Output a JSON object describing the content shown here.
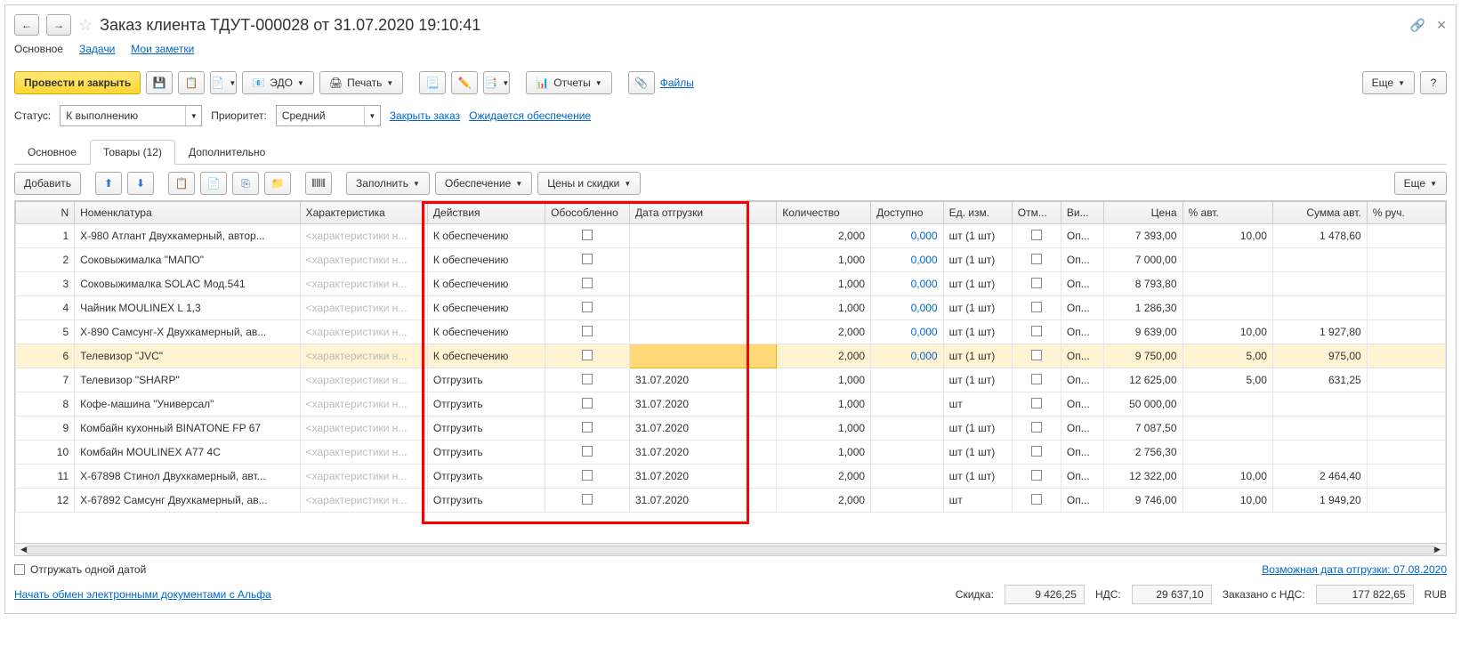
{
  "header": {
    "title": "Заказ клиента ТДУТ-000028 от 31.07.2020 19:10:41"
  },
  "nav": {
    "main": "Основное",
    "tasks": "Задачи",
    "notes": "Мои заметки"
  },
  "toolbar": {
    "post_close": "Провести и закрыть",
    "edo": "ЭДО",
    "print": "Печать",
    "reports": "Отчеты",
    "files": "Файлы",
    "more": "Еще",
    "help": "?"
  },
  "status": {
    "status_label": "Статус:",
    "status_value": "К выполнению",
    "priority_label": "Приоритет:",
    "priority_value": "Средний",
    "close_order": "Закрыть заказ",
    "await_supply": "Ожидается обеспечение"
  },
  "tabs": {
    "main": "Основное",
    "goods": "Товары (12)",
    "addl": "Дополнительно"
  },
  "toolbar2": {
    "add": "Добавить",
    "fill": "Заполнить",
    "supply": "Обеспечение",
    "prices": "Цены и скидки",
    "more": "Еще"
  },
  "columns": {
    "n": "N",
    "name": "Номенклатура",
    "char": "Характеристика",
    "actions": "Действия",
    "obos": "Обособленно",
    "ship_date": "Дата отгрузки",
    "qty": "Количество",
    "avail": "Доступно",
    "unit": "Ед. изм.",
    "otm": "Отм...",
    "vi": "Ви...",
    "price": "Цена",
    "pct_auto": "% авт.",
    "sum_auto": "Сумма авт.",
    "pct_man": "% руч."
  },
  "char_placeholder": "<характеристики н...",
  "rows": [
    {
      "n": 1,
      "name": "Х-980 Атлант Двухкамерный, автор...",
      "action": "К обеспечению",
      "date": "",
      "qty": "2,000",
      "avail": "0,000",
      "unit": "шт (1 шт)",
      "vi": "Оп...",
      "price": "7 393,00",
      "pct": "10,00",
      "sum": "1 478,60"
    },
    {
      "n": 2,
      "name": "Соковыжималка \"МАПО\"",
      "action": "К обеспечению",
      "date": "",
      "qty": "1,000",
      "avail": "0,000",
      "unit": "шт (1 шт)",
      "vi": "Оп...",
      "price": "7 000,00",
      "pct": "",
      "sum": ""
    },
    {
      "n": 3,
      "name": "Соковыжималка  SOLAC  Мод.541",
      "action": "К обеспечению",
      "date": "",
      "qty": "1,000",
      "avail": "0,000",
      "unit": "шт (1 шт)",
      "vi": "Оп...",
      "price": "8 793,80",
      "pct": "",
      "sum": ""
    },
    {
      "n": 4,
      "name": "Чайник MOULINEX L 1,3",
      "action": "К обеспечению",
      "date": "",
      "qty": "1,000",
      "avail": "0,000",
      "unit": "шт (1 шт)",
      "vi": "Оп...",
      "price": "1 286,30",
      "pct": "",
      "sum": ""
    },
    {
      "n": 5,
      "name": "Х-890 Самсунг-Х Двухкамерный, ав...",
      "action": "К обеспечению",
      "date": "",
      "qty": "2,000",
      "avail": "0,000",
      "unit": "шт (1 шт)",
      "vi": "Оп...",
      "price": "9 639,00",
      "pct": "10,00",
      "sum": "1 927,80"
    },
    {
      "n": 6,
      "name": "Телевизор \"JVC\"",
      "action": "К обеспечению",
      "date": "",
      "qty": "2,000",
      "avail": "0,000",
      "unit": "шт (1 шт)",
      "vi": "Оп...",
      "price": "9 750,00",
      "pct": "5,00",
      "sum": "975,00",
      "selected": true
    },
    {
      "n": 7,
      "name": "Телевизор \"SHARP\"",
      "action": "Отгрузить",
      "date": "31.07.2020",
      "qty": "1,000",
      "avail": "",
      "unit": "шт (1 шт)",
      "vi": "Оп...",
      "price": "12 625,00",
      "pct": "5,00",
      "sum": "631,25"
    },
    {
      "n": 8,
      "name": "Кофе-машина \"Универсал\"",
      "action": "Отгрузить",
      "date": "31.07.2020",
      "qty": "1,000",
      "avail": "",
      "unit": "шт",
      "vi": "Оп...",
      "price": "50 000,00",
      "pct": "",
      "sum": ""
    },
    {
      "n": 9,
      "name": "Комбайн кухонный BINATONE FP 67",
      "action": "Отгрузить",
      "date": "31.07.2020",
      "qty": "1,000",
      "avail": "",
      "unit": "шт (1 шт)",
      "vi": "Оп...",
      "price": "7 087,50",
      "pct": "",
      "sum": ""
    },
    {
      "n": 10,
      "name": "Комбайн MOULINEX  А77 4C",
      "action": "Отгрузить",
      "date": "31.07.2020",
      "qty": "1,000",
      "avail": "",
      "unit": "шт (1 шт)",
      "vi": "Оп...",
      "price": "2 756,30",
      "pct": "",
      "sum": ""
    },
    {
      "n": 11,
      "name": "Х-67898 Стинол Двухкамерный, авт...",
      "action": "Отгрузить",
      "date": "31.07.2020",
      "qty": "2,000",
      "avail": "",
      "unit": "шт (1 шт)",
      "vi": "Оп...",
      "price": "12 322,00",
      "pct": "10,00",
      "sum": "2 464,40"
    },
    {
      "n": 12,
      "name": "Х-67892 Самсунг Двухкамерный, ав...",
      "action": "Отгрузить",
      "date": "31.07.2020",
      "qty": "2,000",
      "avail": "",
      "unit": "шт",
      "vi": "Оп...",
      "price": "9 746,00",
      "pct": "10,00",
      "sum": "1 949,20"
    }
  ],
  "footer": {
    "ship_one_date": "Отгружать одной датой",
    "possible_date": "Возможная дата отгрузки: 07.08.2020",
    "start_exchange": "Начать обмен электронными документами с Альфа",
    "discount_label": "Скидка:",
    "discount_value": "9 426,25",
    "vat_label": "НДС:",
    "vat_value": "29 637,10",
    "ordered_label": "Заказано с НДС:",
    "ordered_value": "177 822,65",
    "currency": "RUB"
  }
}
